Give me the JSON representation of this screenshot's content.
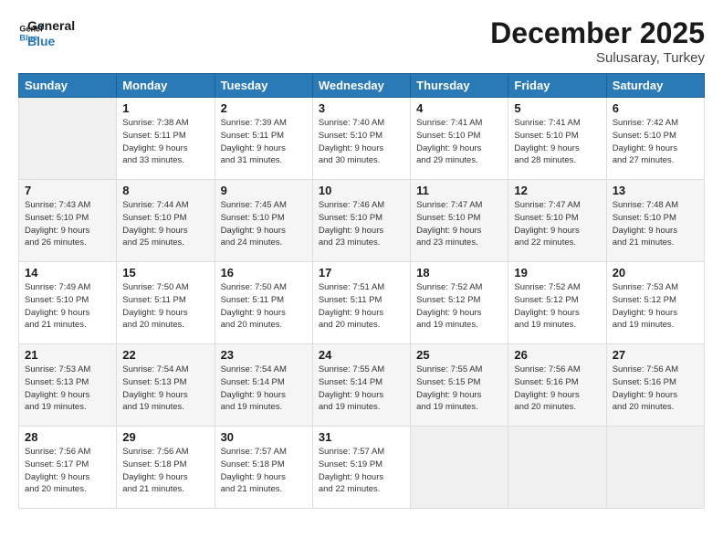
{
  "logo": {
    "line1": "General",
    "line2": "Blue"
  },
  "title": "December 2025",
  "subtitle": "Sulusaray, Turkey",
  "headers": [
    "Sunday",
    "Monday",
    "Tuesday",
    "Wednesday",
    "Thursday",
    "Friday",
    "Saturday"
  ],
  "weeks": [
    [
      {
        "num": "",
        "info": ""
      },
      {
        "num": "1",
        "info": "Sunrise: 7:38 AM\nSunset: 5:11 PM\nDaylight: 9 hours\nand 33 minutes."
      },
      {
        "num": "2",
        "info": "Sunrise: 7:39 AM\nSunset: 5:11 PM\nDaylight: 9 hours\nand 31 minutes."
      },
      {
        "num": "3",
        "info": "Sunrise: 7:40 AM\nSunset: 5:10 PM\nDaylight: 9 hours\nand 30 minutes."
      },
      {
        "num": "4",
        "info": "Sunrise: 7:41 AM\nSunset: 5:10 PM\nDaylight: 9 hours\nand 29 minutes."
      },
      {
        "num": "5",
        "info": "Sunrise: 7:41 AM\nSunset: 5:10 PM\nDaylight: 9 hours\nand 28 minutes."
      },
      {
        "num": "6",
        "info": "Sunrise: 7:42 AM\nSunset: 5:10 PM\nDaylight: 9 hours\nand 27 minutes."
      }
    ],
    [
      {
        "num": "7",
        "info": "Sunrise: 7:43 AM\nSunset: 5:10 PM\nDaylight: 9 hours\nand 26 minutes."
      },
      {
        "num": "8",
        "info": "Sunrise: 7:44 AM\nSunset: 5:10 PM\nDaylight: 9 hours\nand 25 minutes."
      },
      {
        "num": "9",
        "info": "Sunrise: 7:45 AM\nSunset: 5:10 PM\nDaylight: 9 hours\nand 24 minutes."
      },
      {
        "num": "10",
        "info": "Sunrise: 7:46 AM\nSunset: 5:10 PM\nDaylight: 9 hours\nand 23 minutes."
      },
      {
        "num": "11",
        "info": "Sunrise: 7:47 AM\nSunset: 5:10 PM\nDaylight: 9 hours\nand 23 minutes."
      },
      {
        "num": "12",
        "info": "Sunrise: 7:47 AM\nSunset: 5:10 PM\nDaylight: 9 hours\nand 22 minutes."
      },
      {
        "num": "13",
        "info": "Sunrise: 7:48 AM\nSunset: 5:10 PM\nDaylight: 9 hours\nand 21 minutes."
      }
    ],
    [
      {
        "num": "14",
        "info": "Sunrise: 7:49 AM\nSunset: 5:10 PM\nDaylight: 9 hours\nand 21 minutes."
      },
      {
        "num": "15",
        "info": "Sunrise: 7:50 AM\nSunset: 5:11 PM\nDaylight: 9 hours\nand 20 minutes."
      },
      {
        "num": "16",
        "info": "Sunrise: 7:50 AM\nSunset: 5:11 PM\nDaylight: 9 hours\nand 20 minutes."
      },
      {
        "num": "17",
        "info": "Sunrise: 7:51 AM\nSunset: 5:11 PM\nDaylight: 9 hours\nand 20 minutes."
      },
      {
        "num": "18",
        "info": "Sunrise: 7:52 AM\nSunset: 5:12 PM\nDaylight: 9 hours\nand 19 minutes."
      },
      {
        "num": "19",
        "info": "Sunrise: 7:52 AM\nSunset: 5:12 PM\nDaylight: 9 hours\nand 19 minutes."
      },
      {
        "num": "20",
        "info": "Sunrise: 7:53 AM\nSunset: 5:12 PM\nDaylight: 9 hours\nand 19 minutes."
      }
    ],
    [
      {
        "num": "21",
        "info": "Sunrise: 7:53 AM\nSunset: 5:13 PM\nDaylight: 9 hours\nand 19 minutes."
      },
      {
        "num": "22",
        "info": "Sunrise: 7:54 AM\nSunset: 5:13 PM\nDaylight: 9 hours\nand 19 minutes."
      },
      {
        "num": "23",
        "info": "Sunrise: 7:54 AM\nSunset: 5:14 PM\nDaylight: 9 hours\nand 19 minutes."
      },
      {
        "num": "24",
        "info": "Sunrise: 7:55 AM\nSunset: 5:14 PM\nDaylight: 9 hours\nand 19 minutes."
      },
      {
        "num": "25",
        "info": "Sunrise: 7:55 AM\nSunset: 5:15 PM\nDaylight: 9 hours\nand 19 minutes."
      },
      {
        "num": "26",
        "info": "Sunrise: 7:56 AM\nSunset: 5:16 PM\nDaylight: 9 hours\nand 20 minutes."
      },
      {
        "num": "27",
        "info": "Sunrise: 7:56 AM\nSunset: 5:16 PM\nDaylight: 9 hours\nand 20 minutes."
      }
    ],
    [
      {
        "num": "28",
        "info": "Sunrise: 7:56 AM\nSunset: 5:17 PM\nDaylight: 9 hours\nand 20 minutes."
      },
      {
        "num": "29",
        "info": "Sunrise: 7:56 AM\nSunset: 5:18 PM\nDaylight: 9 hours\nand 21 minutes."
      },
      {
        "num": "30",
        "info": "Sunrise: 7:57 AM\nSunset: 5:18 PM\nDaylight: 9 hours\nand 21 minutes."
      },
      {
        "num": "31",
        "info": "Sunrise: 7:57 AM\nSunset: 5:19 PM\nDaylight: 9 hours\nand 22 minutes."
      },
      {
        "num": "",
        "info": ""
      },
      {
        "num": "",
        "info": ""
      },
      {
        "num": "",
        "info": ""
      }
    ]
  ]
}
